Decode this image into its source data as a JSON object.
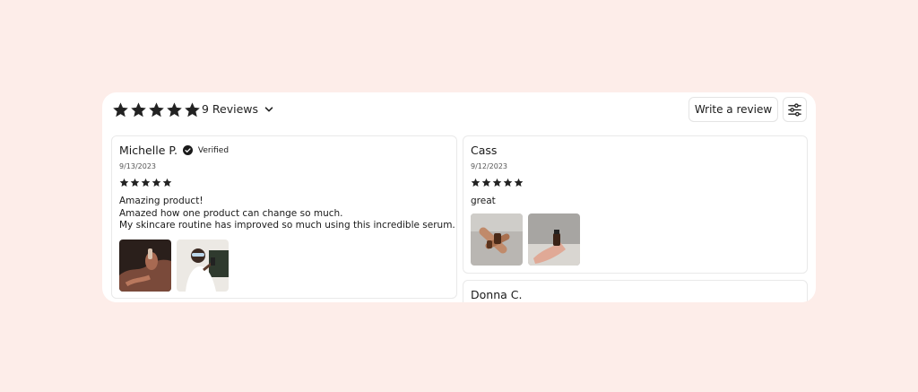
{
  "summary": {
    "rating_stars": 5,
    "reviews_label": "9 Reviews"
  },
  "actions": {
    "write_review_label": "Write a review",
    "filter_icon": "sliders-icon"
  },
  "reviews": [
    {
      "author": "Michelle P.",
      "verified": true,
      "verified_label": "Verified",
      "date": "9/13/2023",
      "rating": 5,
      "body": [
        "Amazing product!",
        "Amazed how one product can change so much.",
        "My skincare routine has improved so much using this incredible serum."
      ],
      "photos": 2
    },
    {
      "author": "Cass",
      "verified": false,
      "date": "9/12/2023",
      "rating": 5,
      "body": [
        "great"
      ],
      "photos": 2
    },
    {
      "author": "Donna C."
    }
  ],
  "colors": {
    "page_background": "#fdede9",
    "star": "#222222",
    "card_border": "#e9e9e9"
  }
}
